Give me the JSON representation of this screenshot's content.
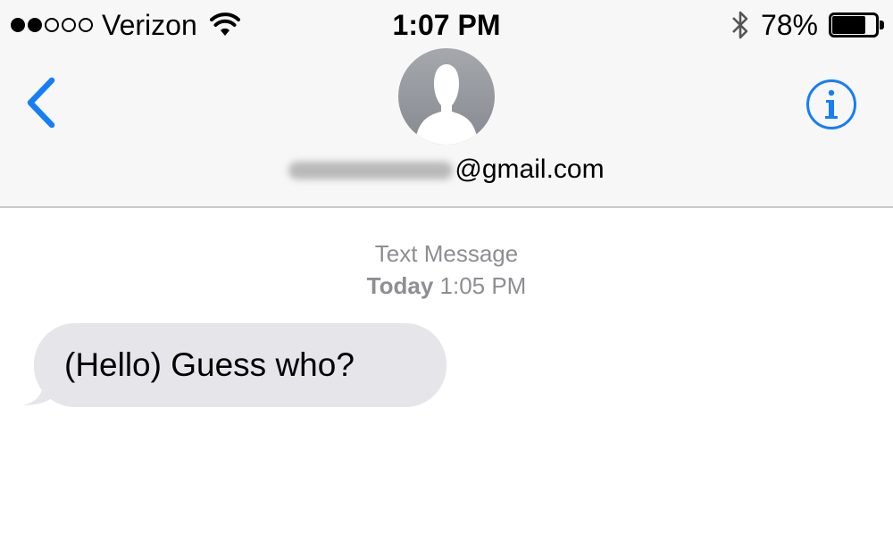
{
  "status_bar": {
    "signal_filled": 2,
    "signal_total": 5,
    "carrier": "Verizon",
    "wifi_icon": "wifi-icon",
    "time": "1:07 PM",
    "bluetooth_icon": "bluetooth-icon",
    "battery_percent": "78%",
    "battery_level": 0.78
  },
  "nav": {
    "back_icon": "chevron-left-icon",
    "avatar_icon": "person-silhouette-icon",
    "contact_suffix": "@gmail.com",
    "info_icon": "info-icon",
    "accent_color": "#147efb"
  },
  "conversation": {
    "service": "Text Message",
    "day": "Today",
    "time": "1:05 PM",
    "messages": [
      {
        "direction": "incoming",
        "text": "(Hello) Guess who?"
      }
    ],
    "bubble_color": "#e5e5ea"
  }
}
